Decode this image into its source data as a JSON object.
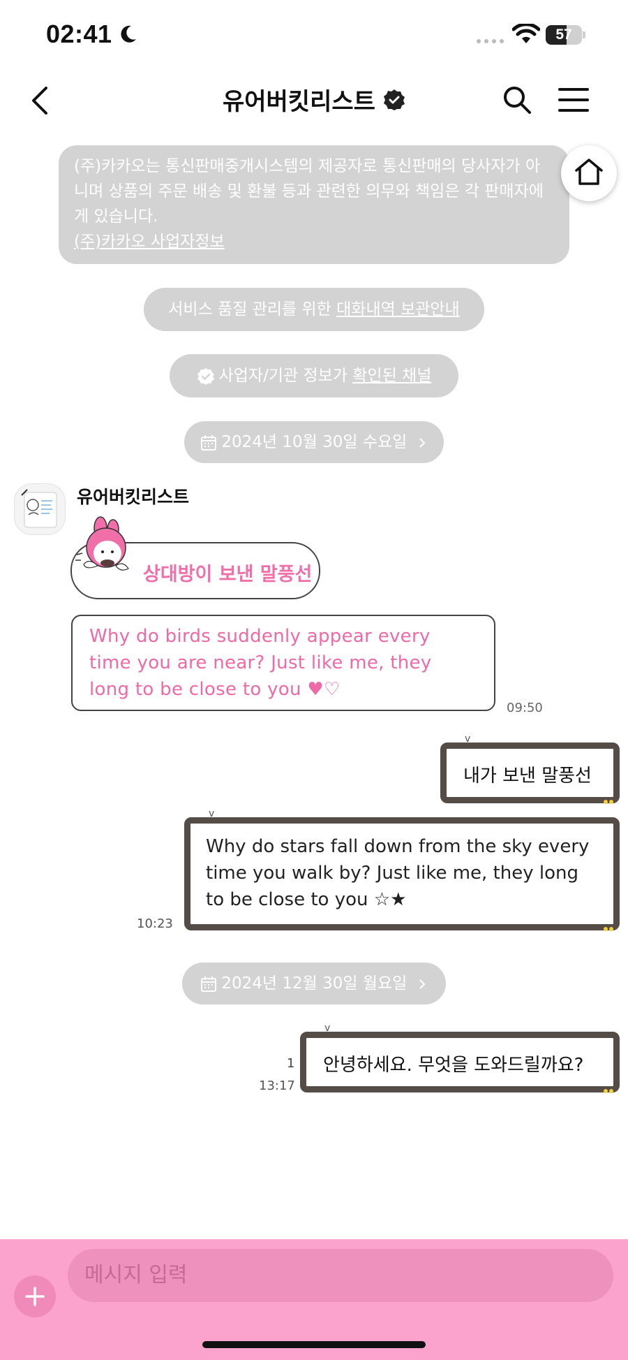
{
  "status_bar": {
    "time": "02:41",
    "battery": "57",
    "battery_level_percent": 57
  },
  "header": {
    "title": "유어버킷리스트"
  },
  "notice": {
    "text": "(주)카카오는 통신판매중개시스템의 제공자로 통신판매의 당사자가 아니며 상품의 주문 배송 및 환불 등과 관련한 의무와 책임은 각 판매자에게 있습니다.",
    "link": "(주)카카오 사업자정보"
  },
  "pills": {
    "archive_prefix": "서비스 품질 관리를 위한 ",
    "archive_link": "대화내역 보관안내",
    "verified_prefix": "사업자/기관 정보가 ",
    "verified_link": "확인된 채널",
    "date1": "2024년 10월 30일 수요일",
    "date2": "2024년 12월 30일 월요일"
  },
  "received": {
    "sender": "유어버킷리스트",
    "bubble1": "상대방이 보낸 말풍선",
    "bubble2": "Why do birds suddenly appear every time you are near? Just like me, they long to be close to you ♥♡",
    "time": "09:50"
  },
  "sent": {
    "bubble1": "내가 보낸 말풍선",
    "bubble2": "Why do stars fall down from the sky every time you walk by? Just like me, they long to be close to you ☆★",
    "time2": "10:23",
    "bubble3": "안녕하세요. 무엇을 도와드릴까요?",
    "read_count": "1",
    "time3": "13:17"
  },
  "input": {
    "placeholder": "메시지 입력"
  },
  "colors": {
    "accent_pink": "#fba3cd",
    "received_text": "#ee6aa7",
    "sent_border": "#554b47",
    "system_pill": "#d3d3d3"
  },
  "icons": [
    "moon-icon",
    "wifi-icon",
    "battery-icon",
    "back-arrow-icon",
    "verified-badge-icon",
    "search-icon",
    "menu-icon",
    "home-icon",
    "calendar-icon",
    "chevron-right-icon",
    "check-badge-icon",
    "plus-icon"
  ]
}
